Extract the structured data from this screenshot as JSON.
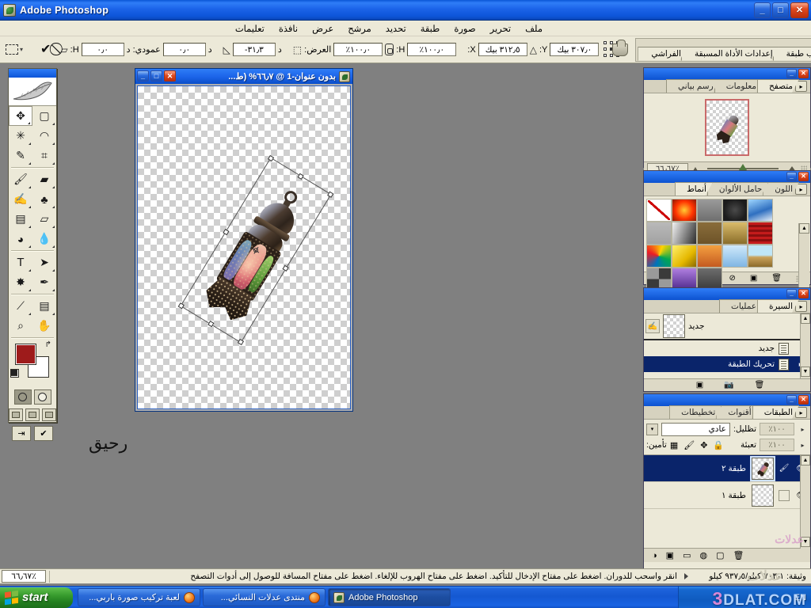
{
  "window": {
    "app_title": "Adobe Photoshop",
    "minimize": "_",
    "maximize": "□",
    "close": "✕"
  },
  "menubar": {
    "items": [
      {
        "label": "ملف"
      },
      {
        "label": "تحرير"
      },
      {
        "label": "صورة"
      },
      {
        "label": "طبقة"
      },
      {
        "label": "تحديد"
      },
      {
        "label": "مرشح"
      },
      {
        "label": "عرض"
      },
      {
        "label": "نافذة"
      },
      {
        "label": "تعليمات"
      }
    ]
  },
  "options_bar": {
    "tool_preset_icon": "marquee-tool-icon",
    "commit_label": "✔",
    "cancel_label": "⃠",
    "fields": [
      {
        "name": "horizontal-skew",
        "label": "د",
        "value": "٠٫٠"
      },
      {
        "name": "vertical-skew-label",
        "label": "عمودي:",
        "value": ""
      },
      {
        "name": "vertical-skew",
        "label": "د",
        "value": "٠٫٠"
      },
      {
        "name": "rotate-label",
        "label": "H:",
        "value": ""
      },
      {
        "name": "rotate-angle",
        "label": "د",
        "value": "٣١٫٣-"
      }
    ],
    "angle_value": "٣١٫٣-",
    "angle_unit": "د",
    "h_skew_value": "٠٫٠",
    "h_skew_unit": "د",
    "v_skew_label": "عمودي:",
    "v_skew_value": "٠٫٠",
    "v_skew_unit": "د",
    "v_skew_h_label": "H:",
    "height_label": "H:",
    "height_value": "١٠٠٫٠٪",
    "width_label": "العرض:",
    "width_value": "١٠٠٫٠٪",
    "y_label": "Y:",
    "y_value": "٣٠٧٫٠ بيك",
    "x_label": "X:",
    "x_value": "٣١٢٫٥ بيك",
    "palette_tabs": [
      {
        "label": "الفراشي"
      },
      {
        "label": "إعدادات الأداة المسبقة"
      },
      {
        "label": "تراكب طبقة"
      }
    ]
  },
  "toolbox": {
    "tools": [
      {
        "name": "move-tool",
        "glyph": "✥"
      },
      {
        "name": "marquee-tool",
        "glyph": "▭"
      },
      {
        "name": "magic-wand-tool",
        "glyph": "✶"
      },
      {
        "name": "lasso-tool",
        "glyph": "◠"
      },
      {
        "name": "healing-brush-tool",
        "glyph": "✎"
      },
      {
        "name": "crop-tool",
        "glyph": "⌗"
      },
      {
        "name": "brush-tool",
        "glyph": "🖌"
      },
      {
        "name": "patch-tool",
        "glyph": "▰"
      },
      {
        "name": "history-brush-tool",
        "glyph": "✍"
      },
      {
        "name": "clone-stamp-tool",
        "glyph": "♣"
      },
      {
        "name": "gradient-tool",
        "glyph": "▤"
      },
      {
        "name": "eraser-tool",
        "glyph": "◻"
      },
      {
        "name": "blur-tool",
        "glyph": "◕"
      },
      {
        "name": "dodge-tool",
        "glyph": "◌"
      },
      {
        "name": "type-tool",
        "glyph": "T"
      },
      {
        "name": "path-selection-tool",
        "glyph": "➤"
      },
      {
        "name": "custom-shape-tool",
        "glyph": "✸"
      },
      {
        "name": "pen-tool",
        "glyph": "✒"
      },
      {
        "name": "eyedropper-tool",
        "glyph": "⟋"
      },
      {
        "name": "notes-tool",
        "glyph": "▤"
      },
      {
        "name": "zoom-tool",
        "glyph": "⌕"
      },
      {
        "name": "hand-tool",
        "glyph": "✋"
      }
    ],
    "foreground_color": "#9e1b1b",
    "background_color": "#ffffff",
    "swap_icon": "↱",
    "quickmask_standard": "standard-mask-mode",
    "quickmask_quick": "quick-mask-mode",
    "screen_modes": [
      "standard-screen-mode",
      "full-screen-menubar-mode",
      "full-screen-mode"
    ],
    "jump_to_imageready": "⇥",
    "logo": "feather-logo"
  },
  "document": {
    "title": "بدون عنوان-1 @ ٦٦٫٧% (ط...",
    "minimize": "_",
    "maximize": "□",
    "close": "✕",
    "canvas_note": "رحيق"
  },
  "navigator": {
    "tabs": [
      {
        "label": "متصفح",
        "active": true
      },
      {
        "label": "معلومات",
        "active": false
      },
      {
        "label": "رسم بياني",
        "active": false
      }
    ],
    "zoom_value": "٦٦٫٦٧٪",
    "menu_arrow": "▸",
    "minimize": "_",
    "close": "✕"
  },
  "styles": {
    "tabs": [
      {
        "label": "اللون",
        "active": false
      },
      {
        "label": "حامل الألوان",
        "active": false
      },
      {
        "label": "أنماط",
        "active": true
      }
    ],
    "swatches": [
      {
        "name": "none-style",
        "css": "linear-gradient(180deg,#ffffff,#ffffff)"
      },
      {
        "name": "red-glow-style",
        "css": "radial-gradient(circle at 50% 50%,#ffcc33,#ff3300 55%,#8b1a00 100%)"
      },
      {
        "name": "gray-bevel-style",
        "css": "linear-gradient(180deg,#9a9a9a,#6f6f6f)"
      },
      {
        "name": "dark-emboss-style",
        "css": "radial-gradient(circle,#4a4a4a,#1c1c1c 70%)"
      },
      {
        "name": "blue-sky-style",
        "css": "linear-gradient(160deg,#9fd6ff 0%,#2f6fc0 55%,#e6eef7 100%)"
      },
      {
        "name": "flat-gray-style",
        "css": "linear-gradient(180deg,#b9b9b9,#a2a2a2)"
      },
      {
        "name": "silver-fade-style",
        "css": "linear-gradient(110deg,#f2f2f2,#2b2b2b)"
      },
      {
        "name": "brown-style",
        "css": "linear-gradient(180deg,#8a6d3b,#6d5328)"
      },
      {
        "name": "gold-style",
        "css": "linear-gradient(180deg,#d9bb6a,#8a6d2a)"
      },
      {
        "name": "red-stripe-style",
        "css": "repeating-linear-gradient(0deg,#c41b1b 0 3px,#8a0f0f 3px 6px)"
      },
      {
        "name": "rainbow-abstract-style",
        "css": "conic-gradient(from 20deg,#ffd400,#00a651,#0072bc,#ed1c24,#ffd400)"
      },
      {
        "name": "yellow-satin-style",
        "css": "linear-gradient(135deg,#fff06b,#e5b800 60%,#8a6a00)"
      },
      {
        "name": "sunset-style",
        "css": "linear-gradient(180deg,#f4a040,#c45a20)"
      },
      {
        "name": "ice-blue-style",
        "css": "linear-gradient(180deg,#cfe9fb,#7fb6e3)"
      },
      {
        "name": "beach-style",
        "css": "linear-gradient(180deg,#bfe6f7 45%,#caa25a 55%,#8c6b2a)"
      },
      {
        "name": "noise-style",
        "css": "repeating-conic-gradient(#3a3a3a 0 25%,#9a9a9a 0 50%)"
      },
      {
        "name": "purple-gradient-style",
        "css": "linear-gradient(180deg,#b07fe0,#4f2a8c)"
      },
      {
        "name": "charcoal-style",
        "css": "linear-gradient(180deg,#6d6d6d,#3a3a3a)"
      }
    ],
    "footer_icons": [
      {
        "name": "clear-style-icon",
        "glyph": "⊘"
      },
      {
        "name": "new-style-icon",
        "glyph": "▣"
      },
      {
        "name": "delete-style-icon",
        "glyph": "🗑"
      }
    ],
    "minimize": "_",
    "close": "✕",
    "menu_arrow": "▸"
  },
  "history": {
    "tabs": [
      {
        "label": "السيرة",
        "active": true
      },
      {
        "label": "عمليات",
        "active": false
      }
    ],
    "snapshot_label": "جديد",
    "states": [
      {
        "label": "جديد",
        "selected": false
      },
      {
        "label": "تحريك الطبقة",
        "selected": true
      }
    ],
    "footer_icons": [
      {
        "name": "new-document-from-state-icon",
        "glyph": "▣"
      },
      {
        "name": "new-snapshot-icon",
        "glyph": "📷"
      },
      {
        "name": "delete-state-icon",
        "glyph": "🗑"
      }
    ],
    "minimize": "_",
    "close": "✕",
    "menu_arrow": "▸"
  },
  "layers": {
    "tabs": [
      {
        "label": "الطبقات",
        "active": true
      },
      {
        "label": "أقنوات",
        "active": false
      },
      {
        "label": "تخطيطات",
        "active": false
      }
    ],
    "blend_mode": "عادي",
    "opacity_label": "تظليل:",
    "opacity_value": "١٠٠٪",
    "fill_label": "تعبئة",
    "fill_value": "١٠٠٪",
    "lock_label": "تأمين:",
    "lock_icons": [
      {
        "name": "lock-transparent-pixels-icon",
        "glyph": "▦"
      },
      {
        "name": "lock-image-pixels-icon",
        "glyph": "🖌"
      },
      {
        "name": "lock-position-icon",
        "glyph": "✥"
      },
      {
        "name": "lock-all-icon",
        "glyph": "🔒"
      }
    ],
    "items": [
      {
        "name": "layer-2",
        "label": "طبقة ٢",
        "visible": true,
        "selected": true
      },
      {
        "name": "layer-1",
        "label": "طبقة ١",
        "visible": true,
        "selected": false
      }
    ],
    "footer_icons": [
      {
        "name": "link-layers-icon",
        "glyph": "⛓"
      },
      {
        "name": "layer-style-icon",
        "glyph": "◑"
      },
      {
        "name": "add-layer-mask-icon",
        "glyph": "▭"
      },
      {
        "name": "new-group-icon",
        "glyph": "▢"
      },
      {
        "name": "new-adjustment-layer-icon",
        "glyph": "◍"
      },
      {
        "name": "new-layer-icon",
        "glyph": "▣"
      },
      {
        "name": "delete-layer-icon",
        "glyph": "🗑"
      }
    ],
    "minimize": "_",
    "close": "✕",
    "menu_arrow": "▸"
  },
  "statusbar": {
    "zoom": "٦٦٫٦٧٪",
    "doc_size": "وثيقة: ٧٠٣٫١ كيلو/٩٣٧٫٥ كيلو",
    "hint": "انقر واسحب للدوران. اضغط على مفتاح الإدخال للتأكيد. اضغط على مفتاح الهروب للإلغاء. اضغط على مفتاح المسافة للوصول إلى أدوات التصفح"
  },
  "taskbar": {
    "start_label": "start",
    "items": [
      {
        "name": "taskbar-item-barbie-game",
        "label": "لعبة تركيب صورة باربي...",
        "icon": "firefox-icon",
        "active": false,
        "rtl": true
      },
      {
        "name": "taskbar-item-forum",
        "label": "منتدى عدلات النسائي...",
        "icon": "firefox-icon",
        "active": false,
        "rtl": true
      },
      {
        "name": "taskbar-item-photoshop",
        "label": "Adobe Photoshop",
        "icon": "photoshop-icon",
        "active": true,
        "rtl": false
      }
    ],
    "language": "EN",
    "watermark_prefix": "3",
    "watermark_text": "DLAT.COM"
  }
}
